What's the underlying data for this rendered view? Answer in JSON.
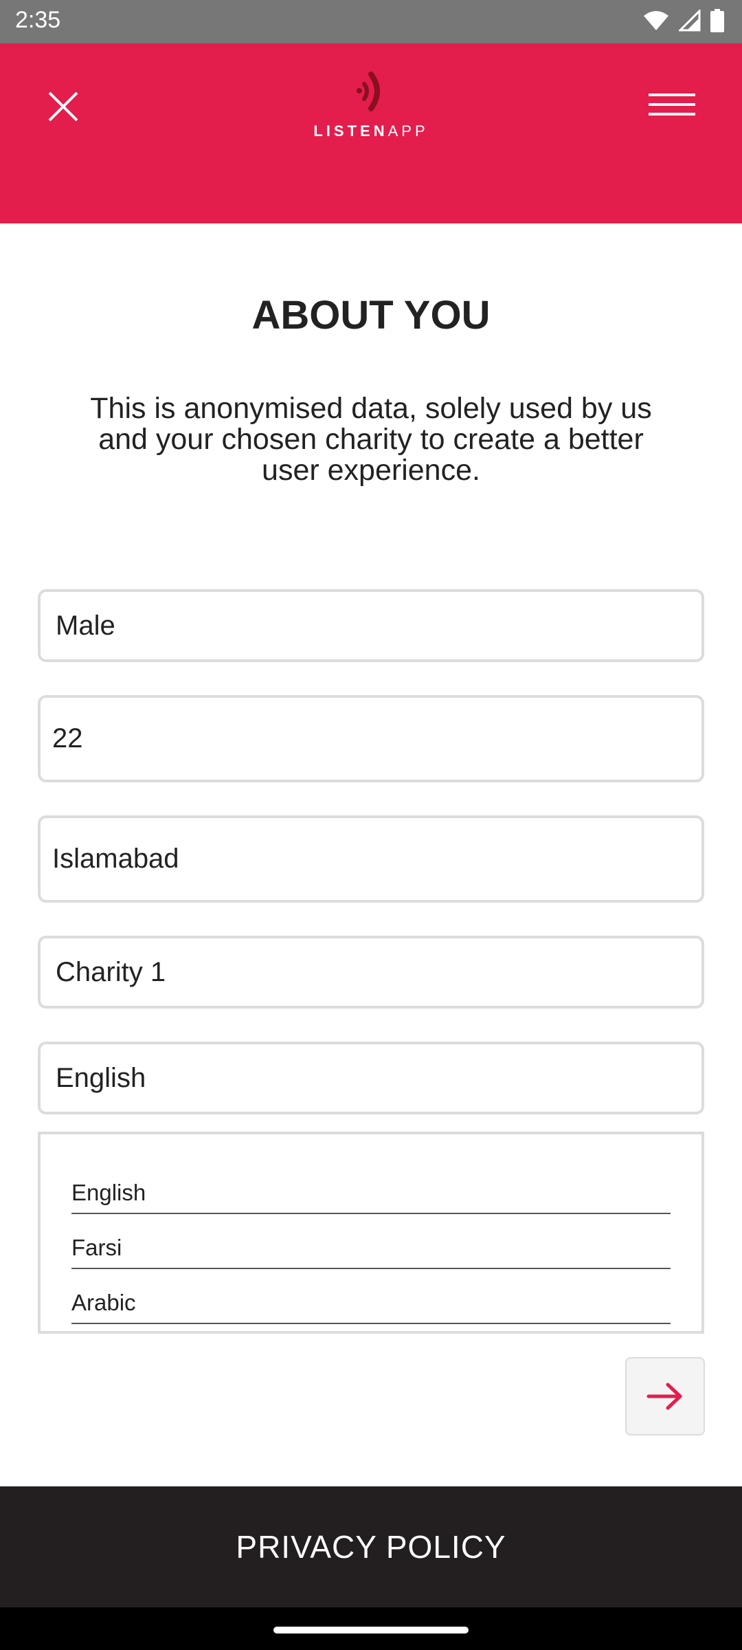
{
  "status_bar": {
    "time": "2:35",
    "icons": [
      "wifi-icon",
      "signal-icon",
      "battery-icon"
    ]
  },
  "header": {
    "logo_text_bold": "LISTEN",
    "logo_text_light": "APP",
    "background_color": "#e31d4c",
    "close_icon": "close-icon",
    "menu_icon": "hamburger-menu-icon"
  },
  "main": {
    "title": "ABOUT YOU",
    "subtitle": "This is anonymised data, solely used by us and your chosen charity to create a better user experience.",
    "fields": {
      "gender": "Male",
      "age": "22",
      "city": "Islamabad",
      "charity": "Charity 1",
      "language": "English"
    },
    "language_options": [
      "English",
      "Farsi",
      "Arabic"
    ],
    "next_icon": "arrow-right-icon"
  },
  "footer": {
    "privacy_label": "PRIVACY POLICY"
  }
}
